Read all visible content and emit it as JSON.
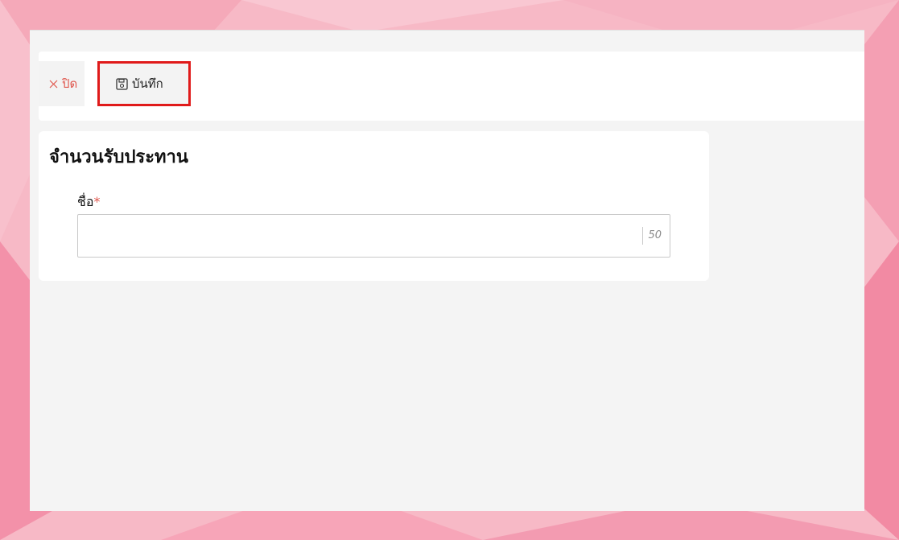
{
  "toolbar": {
    "close_label": "ปิด",
    "save_label": "บันทึก"
  },
  "form": {
    "title": "จำนวนรับประทาน",
    "name_field": {
      "label": "ชื่อ",
      "required_mark": "*",
      "value": "",
      "char_limit": "50"
    }
  },
  "icons": {
    "close": "close-icon",
    "save": "save-icon"
  },
  "colors": {
    "accent_red": "#e0584f",
    "highlight": "#e01a1a",
    "background": "#f7b9c6"
  }
}
